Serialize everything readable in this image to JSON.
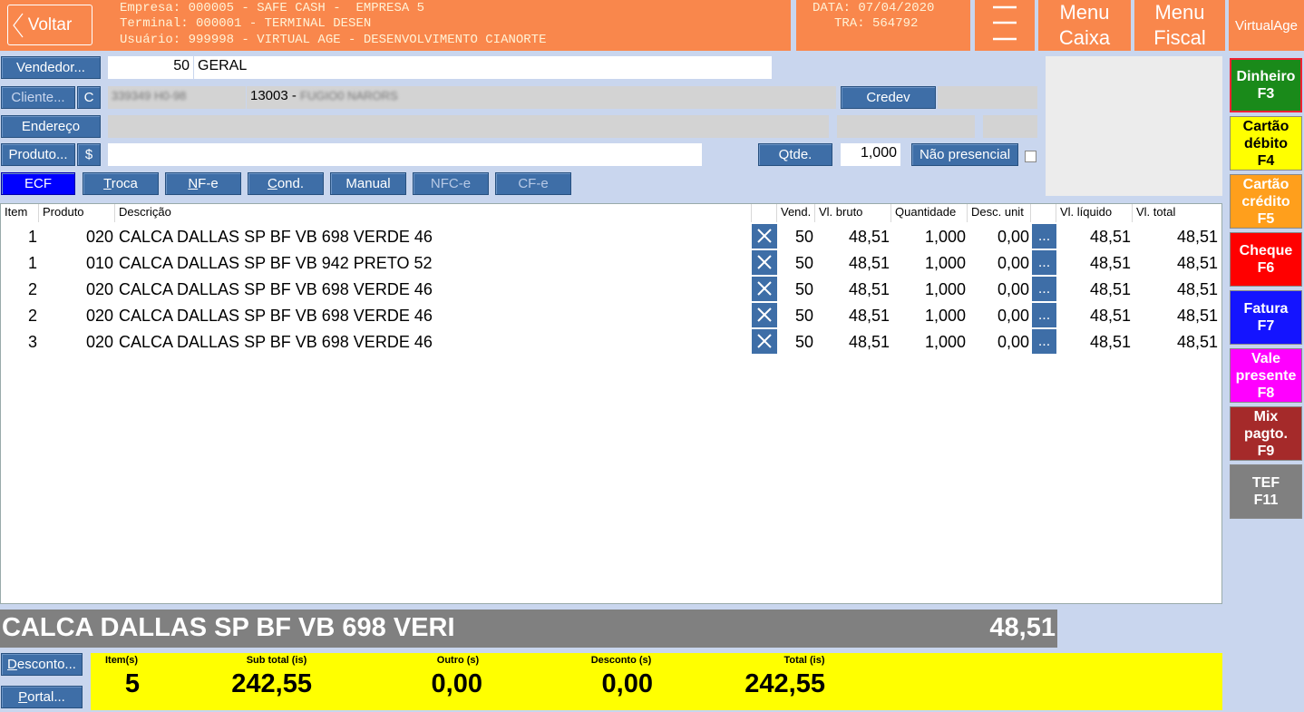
{
  "header": {
    "back_label": "Voltar",
    "empresa_line": "Empresa: 000005 - SAFE CASH -  EMPRESA 5",
    "terminal_line": "Terminal: 000001 - TERMINAL DESEN",
    "usuario_line": "Usuário: 999998 - VIRTUAL AGE - DESENVOLVIMENTO CIANORTE",
    "date_line": "DATA: 07/04/2020",
    "tra_line": "TRA: 564792",
    "menu_caixa": [
      "Menu",
      "Caixa"
    ],
    "menu_fiscal": [
      "Menu",
      "Fiscal"
    ],
    "brand": "VirtualAge"
  },
  "form": {
    "vendedor_label": "Vendedor...",
    "vendedor_code": "50",
    "vendedor_name": "GERAL",
    "cliente_label": "Cliente...",
    "cliente_c": "C",
    "cliente_doc": "339349 H0-98",
    "cliente_name_prefix": "13003 - ",
    "cliente_name": "FUGIO0 NARORS",
    "credev_label": "Credev",
    "endereco_label": "Endereço",
    "produto_label": "Produto...",
    "produto_dollar": "$",
    "produto_value": "",
    "qtde_label": "Qtde.",
    "qtde_value": "1,000",
    "nao_presencial_label": "Não presencial"
  },
  "doc_types": [
    {
      "label": "ECF",
      "key": "",
      "active": true
    },
    {
      "label": "roca",
      "key": "T",
      "active": false
    },
    {
      "label": "F-e",
      "key": "N",
      "active": false
    },
    {
      "label": "ond.",
      "key": "C",
      "active": false
    },
    {
      "label": "Manual",
      "key": "",
      "active": false
    },
    {
      "label": "NFC-e",
      "key": "",
      "active": false
    },
    {
      "label": "CF-e",
      "key": "",
      "active": false
    }
  ],
  "table": {
    "headers": {
      "item": "Item",
      "produto": "Produto",
      "descricao": "Descrição",
      "vend": "Vend.",
      "vl_bruto": "Vl. bruto",
      "quantidade": "Quantidade",
      "desc_unit": "Desc. unit",
      "vl_liquido": "Vl. líquido",
      "vl_total": "Vl. total"
    },
    "rows": [
      {
        "item": "1",
        "produto": "020",
        "descricao": "CALCA DALLAS SP BF VB 698 VERDE 46",
        "vend": "50",
        "vl_bruto": "48,51",
        "quantidade": "1,000",
        "desc_unit": "0,00",
        "vl_liquido": "48,51",
        "vl_total": "48,51"
      },
      {
        "item": "1",
        "produto": "010",
        "descricao": "CALCA DALLAS SP BF VB 942 PRETO 52",
        "vend": "50",
        "vl_bruto": "48,51",
        "quantidade": "1,000",
        "desc_unit": "0,00",
        "vl_liquido": "48,51",
        "vl_total": "48,51"
      },
      {
        "item": "2",
        "produto": "020",
        "descricao": "CALCA DALLAS SP BF VB 698 VERDE 46",
        "vend": "50",
        "vl_bruto": "48,51",
        "quantidade": "1,000",
        "desc_unit": "0,00",
        "vl_liquido": "48,51",
        "vl_total": "48,51"
      },
      {
        "item": "2",
        "produto": "020",
        "descricao": "CALCA DALLAS SP BF VB 698 VERDE 46",
        "vend": "50",
        "vl_bruto": "48,51",
        "quantidade": "1,000",
        "desc_unit": "0,00",
        "vl_liquido": "48,51",
        "vl_total": "48,51"
      },
      {
        "item": "3",
        "produto": "020",
        "descricao": "CALCA DALLAS SP BF VB 698 VERDE 46",
        "vend": "50",
        "vl_bruto": "48,51",
        "quantidade": "1,000",
        "desc_unit": "0,00",
        "vl_liquido": "48,51",
        "vl_total": "48,51"
      }
    ],
    "more_label": "..."
  },
  "payments": [
    {
      "line1": "Dinheiro",
      "line2": "",
      "key": "F3",
      "bg": "#1a8a1a",
      "fg": "#ffffff"
    },
    {
      "line1": "Cartão",
      "line2": "débito",
      "key": "F4",
      "bg": "#ffff00",
      "fg": "#000000"
    },
    {
      "line1": "Cartão",
      "line2": "crédito",
      "key": "F5",
      "bg": "#ff9f1c",
      "fg": "#ffffff"
    },
    {
      "line1": "Cheque",
      "line2": "",
      "key": "F6",
      "bg": "#ff0000",
      "fg": "#ffffff"
    },
    {
      "line1": "Fatura",
      "line2": "",
      "key": "F7",
      "bg": "#1414ff",
      "fg": "#ffffff"
    },
    {
      "line1": "Vale",
      "line2": "presente",
      "key": "F8",
      "bg": "#ff00ff",
      "fg": "#ffffff"
    },
    {
      "line1": "Mix",
      "line2": "pagto.",
      "key": "F9",
      "bg": "#a52a2a",
      "fg": "#ffffff"
    },
    {
      "line1": "TEF",
      "line2": "",
      "key": "F11",
      "bg": "#808080",
      "fg": "#ffffff"
    }
  ],
  "status_bar": {
    "description": "CALCA DALLAS SP BF VB 698 VERI",
    "value": "48,51"
  },
  "footer": {
    "desconto_key": "D",
    "desconto_rest": "esconto...",
    "portal_key": "P",
    "portal_rest": "ortal...",
    "items_label": "Item(s)",
    "items_value": "5",
    "subtotal_label": "Sub total (is)",
    "subtotal_value": "242,55",
    "outro_label": "Outro (s)",
    "outro_value": "0,00",
    "desconto_label": "Desconto (s)",
    "desconto_value": "0,00",
    "total_label": "Total (is)",
    "total_value": "242,55"
  }
}
